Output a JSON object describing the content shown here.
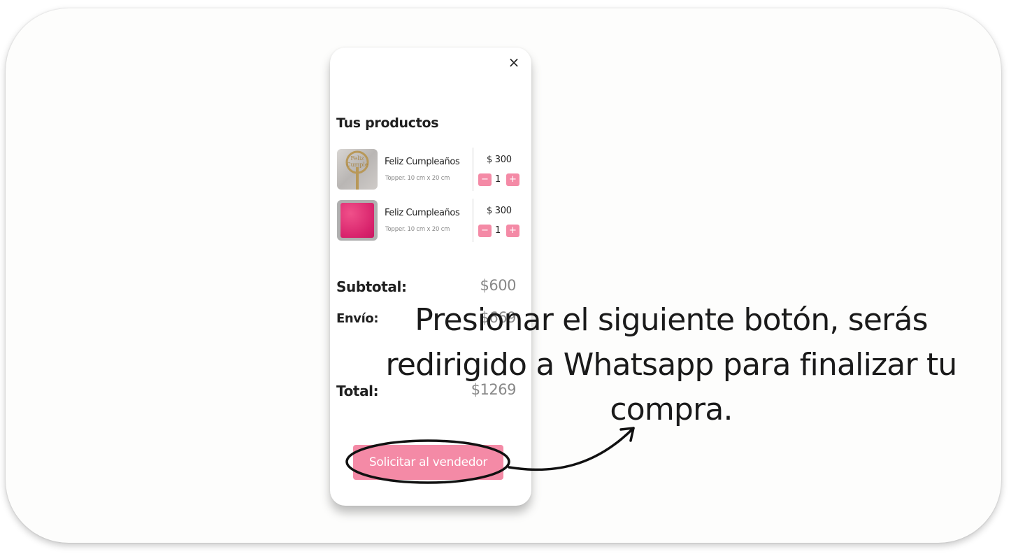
{
  "modal": {
    "close_symbol": "×",
    "section_title": "Tus productos",
    "items": [
      {
        "title": "Feliz Cumpleaños",
        "subtitle": "Topper. 10 cm x 20 cm",
        "price": "$ 300",
        "quantity": "1",
        "minus": "−",
        "plus": "+",
        "thumb_text": "Feliz Cumple"
      },
      {
        "title": "Feliz Cumpleaños",
        "subtitle": "Topper. 10 cm x 20 cm",
        "price": "$ 300",
        "quantity": "1",
        "minus": "−",
        "plus": "+"
      }
    ],
    "subtotal_label": "Subtotal:",
    "subtotal_value": "$600",
    "shipping_label": "Envío:",
    "shipping_value": "$669",
    "total_label": "Total:",
    "total_value": "$1269",
    "cta_label": "Solicitar al vendedor"
  },
  "annotation": {
    "text": "Presionar el siguiente botón, serás redirigido a Whatsapp para finalizar tu compra."
  },
  "colors": {
    "accent": "#f48aa6",
    "text": "#1f1f1f",
    "muted": "#888888"
  }
}
